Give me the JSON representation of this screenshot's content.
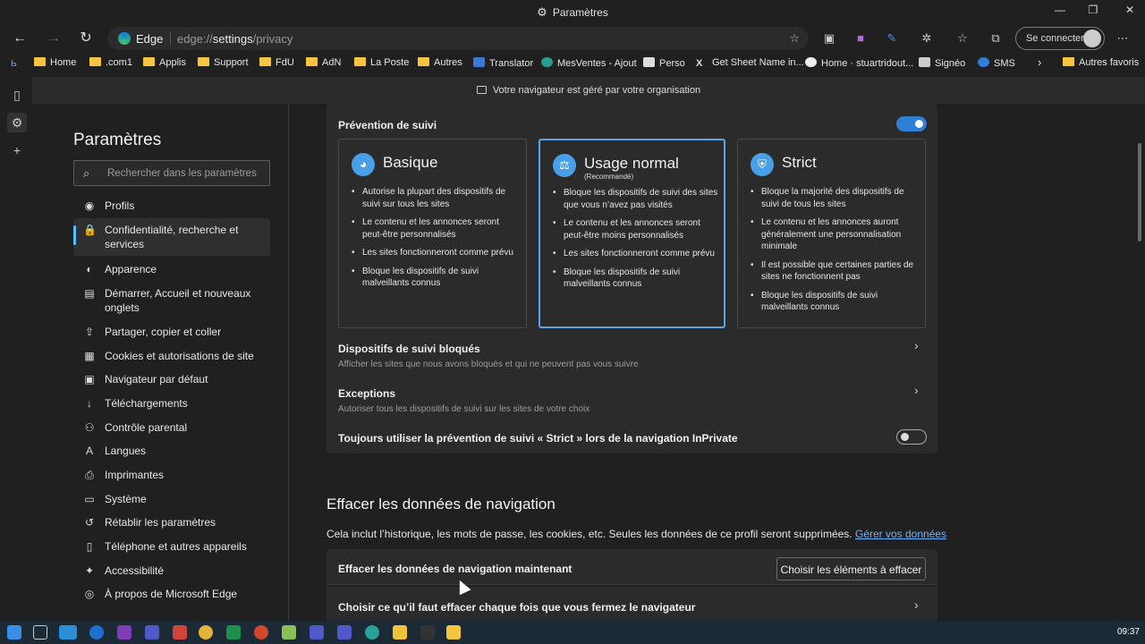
{
  "window": {
    "title": "Paramètres",
    "minimize": "—",
    "maximize": "❐",
    "close": "✕"
  },
  "navbar": {
    "edge_label": "Edge",
    "url_prefix": "edge://",
    "url_path": "settings",
    "url_suffix": "/privacy",
    "signin_label": "Se connecter"
  },
  "bookmarks": [
    {
      "label": "Home",
      "type": "folder"
    },
    {
      "label": ".com1",
      "type": "folder"
    },
    {
      "label": "Applis",
      "type": "folder"
    },
    {
      "label": "Support",
      "type": "folder"
    },
    {
      "label": "FdU",
      "type": "folder"
    },
    {
      "label": "AdN",
      "type": "folder"
    },
    {
      "label": "La Poste",
      "type": "folder"
    },
    {
      "label": "Autres",
      "type": "folder"
    },
    {
      "label": "Translator",
      "type": "site"
    },
    {
      "label": "MesVentes - Ajout",
      "type": "site"
    },
    {
      "label": "Perso",
      "type": "site"
    },
    {
      "label": "Get Sheet Name in...",
      "type": "site"
    },
    {
      "label": "Home · stuartridout...",
      "type": "site"
    },
    {
      "label": "Signéo",
      "type": "site"
    },
    {
      "label": "SMS",
      "type": "site"
    },
    {
      "label": "Autres favoris",
      "type": "folder"
    }
  ],
  "managed_banner": "Votre navigateur est géré par votre organisation",
  "sidebar": {
    "title": "Paramètres",
    "search_placeholder": "Rechercher dans les paramètres",
    "items": [
      {
        "label": "Profils",
        "icon": "profile-icon"
      },
      {
        "label": "Confidentialité, recherche et services",
        "icon": "lock-icon"
      },
      {
        "label": "Apparence",
        "icon": "appearance-icon"
      },
      {
        "label": "Démarrer, Accueil et nouveaux onglets",
        "icon": "home-tab-icon"
      },
      {
        "label": "Partager, copier et coller",
        "icon": "share-icon"
      },
      {
        "label": "Cookies et autorisations de site",
        "icon": "cookie-icon"
      },
      {
        "label": "Navigateur par défaut",
        "icon": "browser-icon"
      },
      {
        "label": "Téléchargements",
        "icon": "download-icon"
      },
      {
        "label": "Contrôle parental",
        "icon": "family-icon"
      },
      {
        "label": "Langues",
        "icon": "language-icon"
      },
      {
        "label": "Imprimantes",
        "icon": "printer-icon"
      },
      {
        "label": "Système",
        "icon": "system-icon"
      },
      {
        "label": "Rétablir les paramètres",
        "icon": "reset-icon"
      },
      {
        "label": "Téléphone et autres appareils",
        "icon": "phone-icon"
      },
      {
        "label": "Accessibilité",
        "icon": "accessibility-icon"
      },
      {
        "label": "À propos de Microsoft Edge",
        "icon": "edge-icon"
      }
    ]
  },
  "tracking": {
    "title": "Prévention de suivi",
    "enabled": true,
    "levels": [
      {
        "name": "Basique",
        "subtitle": "",
        "bullets": [
          "Autorise la plupart des dispositifs de suivi sur tous les sites",
          "Le contenu et les annonces seront peut-être personnalisés",
          "Les sites fonctionneront comme prévu",
          "Bloque les dispositifs de suivi malveillants connus"
        ]
      },
      {
        "name": "Usage normal",
        "subtitle": "(Recommandé)",
        "bullets": [
          "Bloque les dispositifs de suivi des sites que vous n’avez pas visités",
          "Le contenu et les annonces seront peut-être moins personnalisés",
          "Les sites fonctionneront comme prévu",
          "Bloque les dispositifs de suivi malveillants connus"
        ]
      },
      {
        "name": "Strict",
        "subtitle": "",
        "bullets": [
          "Bloque la majorité des dispositifs de suivi de tous les sites",
          "Le contenu et les annonces auront généralement une personnalisation minimale",
          "Il est possible que certaines parties de sites ne fonctionnent pas",
          "Bloque les dispositifs de suivi malveillants connus"
        ]
      }
    ],
    "blocked_title": "Dispositifs de suivi bloqués",
    "blocked_sub": "Afficher les sites que nous avons bloqués et qui ne peuvent pas vous suivre",
    "exceptions_title": "Exceptions",
    "exceptions_sub": "Autoriser tous les dispositifs de suivi sur les sites de votre choix",
    "inprivate_label": "Toujours utiliser la prévention de suivi « Strict » lors de la navigation InPrivate",
    "inprivate_enabled": false
  },
  "clear": {
    "heading": "Effacer les données de navigation",
    "desc": "Cela inclut l’historique, les mots de passe, les cookies, etc. Seules les données de ce profil seront supprimées.",
    "link": "Gérer vos données",
    "now_label": "Effacer les données de navigation maintenant",
    "choose_button": "Choisir les éléments à effacer",
    "onclose_label": "Choisir ce qu’il faut effacer chaque fois que vous fermez le navigateur"
  },
  "taskbar": {
    "clock": "09:37"
  }
}
